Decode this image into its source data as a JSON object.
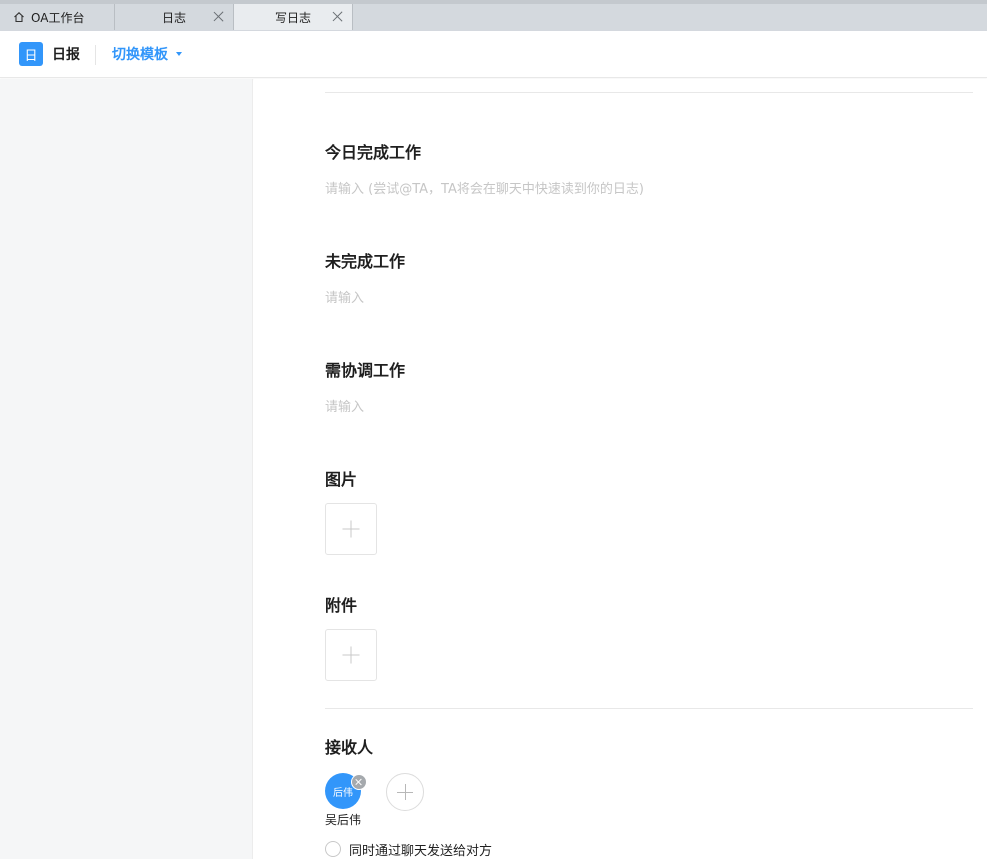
{
  "tabs": [
    {
      "label": "OA工作台",
      "icon": "home-icon",
      "active": false
    },
    {
      "label": "日志",
      "closable": true,
      "active": false
    },
    {
      "label": "写日志",
      "closable": true,
      "active": true
    }
  ],
  "header": {
    "badge": "日",
    "title": "日报",
    "switch_template": "切换模板"
  },
  "sections": {
    "today_done": {
      "title": "今日完成工作",
      "placeholder": "请输入 (尝试@TA，TA将会在聊天中快速读到你的日志)"
    },
    "not_done": {
      "title": "未完成工作",
      "placeholder": "请输入"
    },
    "coordinate": {
      "title": "需协调工作",
      "placeholder": "请输入"
    },
    "images": {
      "title": "图片"
    },
    "attachments": {
      "title": "附件"
    },
    "receivers": {
      "title": "接收人",
      "people": [
        {
          "avatar_text": "后伟",
          "name": "吴后伟"
        }
      ]
    }
  },
  "send_via_chat_label": "同时通过聊天发送给对方",
  "colors": {
    "accent": "#3296fa",
    "placeholder": "#c6c6c6",
    "sidebar_bg": "#f5f6f7",
    "tab_bg": "#d4d9de"
  }
}
